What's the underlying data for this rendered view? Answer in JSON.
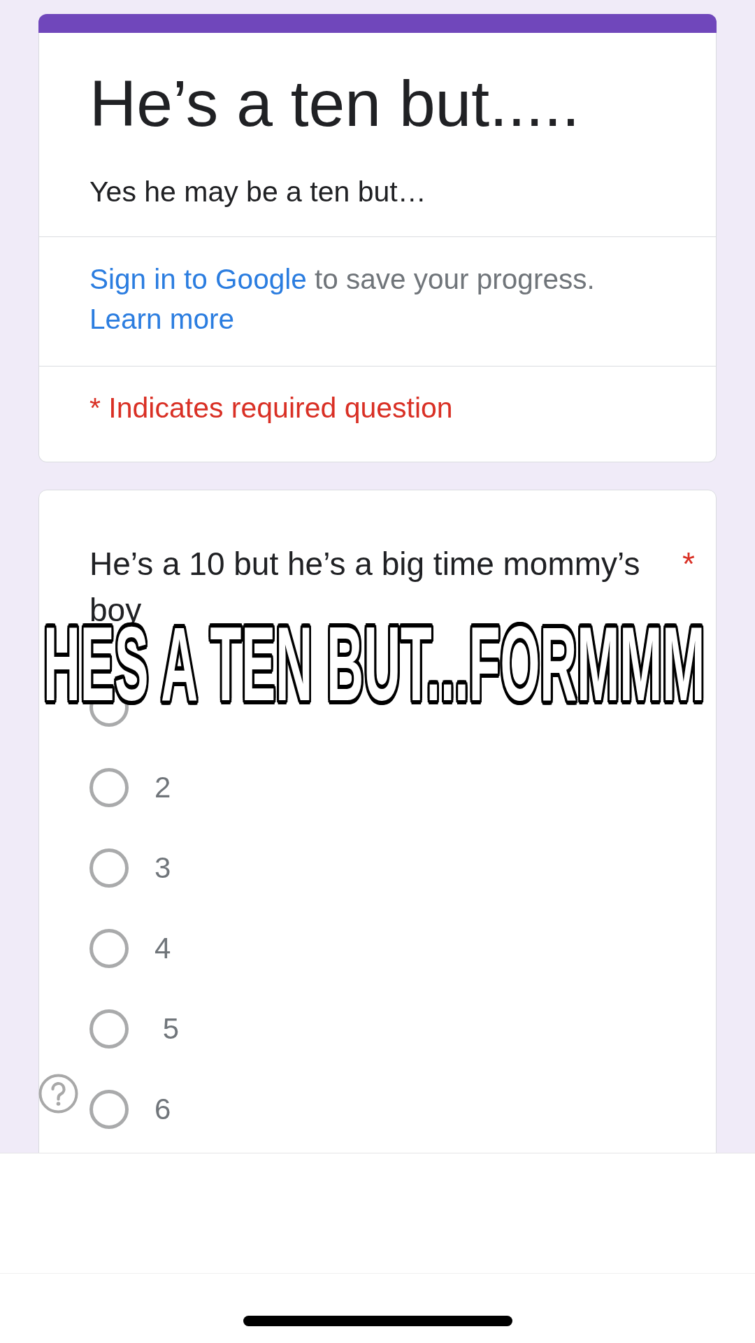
{
  "form_header": {
    "title": "He’s a ten but.....",
    "description": "Yes he may be a ten but…"
  },
  "sign_in_notice": {
    "link": "Sign in to Google",
    "text": "to save your progress.",
    "learn_more": "Learn more"
  },
  "required_notice": "* Indicates required question",
  "question": {
    "text": "He’s a 10 but he’s a big time mommy’s boy",
    "required_mark": "*",
    "options": [
      {
        "selected": false
      },
      {
        "label": "2",
        "selected": false
      },
      {
        "label": "3",
        "selected": false
      },
      {
        "label": "4",
        "selected": false
      },
      {
        "label": " 5",
        "selected": false
      },
      {
        "label": "6",
        "selected": false
      }
    ]
  },
  "overlay_caption": "HES A TEN BUT...FORMMM"
}
